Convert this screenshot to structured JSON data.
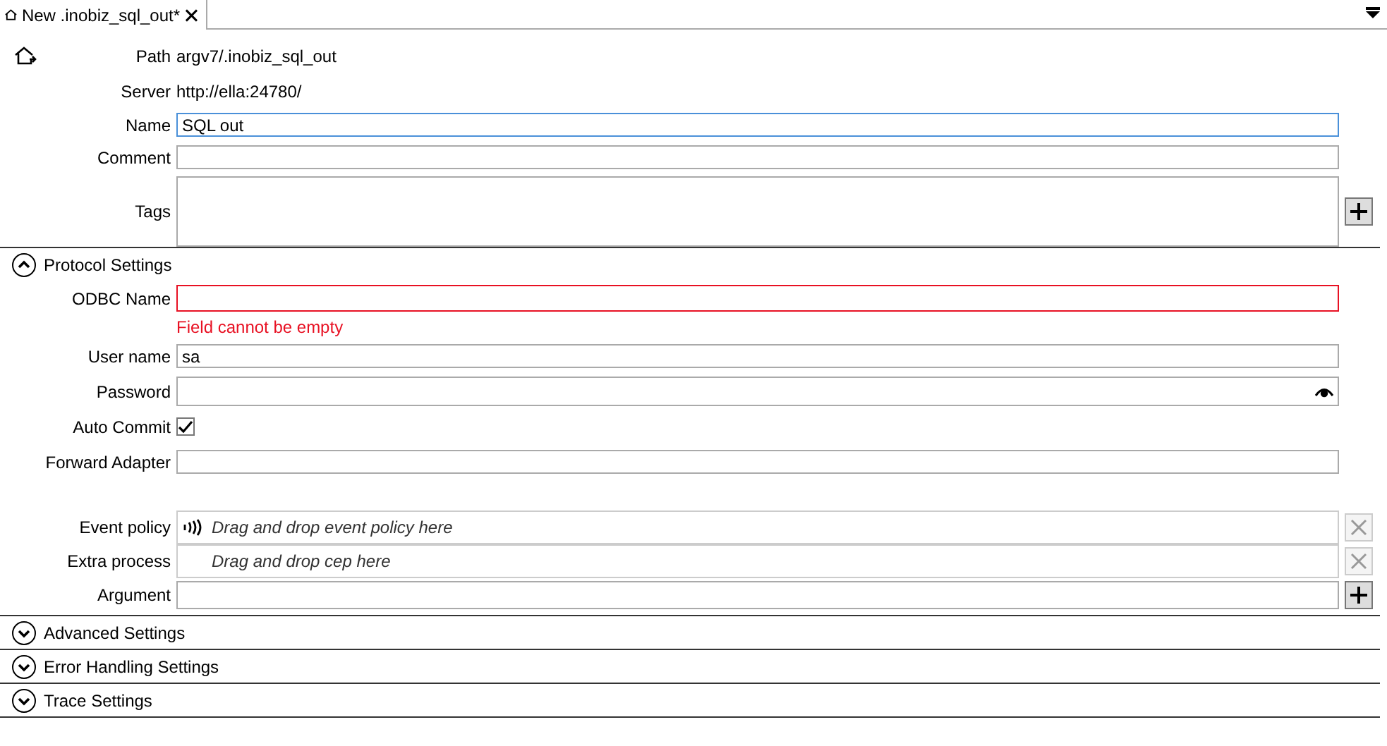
{
  "tab": {
    "title": "New .inobiz_sql_out*"
  },
  "general": [
    {
      "kind": "text",
      "label": "Path",
      "value": "argv7/.inobiz_sql_out"
    },
    {
      "kind": "text",
      "label": "Server",
      "value": "http://ella:24780/"
    },
    {
      "kind": "input",
      "label": "Name",
      "value": "SQL out",
      "focused": true
    },
    {
      "kind": "input",
      "label": "Comment",
      "focused": false
    },
    {
      "kind": "tags",
      "label": "Tags"
    }
  ],
  "sections": [
    {
      "title": "Protocol Settings",
      "expanded": true,
      "fields": [
        {
          "kind": "input",
          "label": "ODBC Name",
          "error": "Field cannot be empty"
        },
        {
          "kind": "input",
          "label": "User name",
          "value": "sa"
        },
        {
          "kind": "password",
          "label": "Password"
        },
        {
          "kind": "checkbox",
          "label": "Auto Commit",
          "checked": true
        },
        {
          "kind": "input",
          "label": "Forward Adapter"
        },
        {
          "kind": "spacer"
        },
        {
          "kind": "drop",
          "label": "Event policy",
          "placeholder": "Drag and drop event policy here",
          "icon": true
        },
        {
          "kind": "drop",
          "label": "Extra process",
          "placeholder": "Drag and drop cep here",
          "icon": false
        },
        {
          "kind": "argument",
          "label": "Argument"
        }
      ]
    },
    {
      "title": "Advanced Settings",
      "expanded": false
    },
    {
      "title": "Error Handling Settings",
      "expanded": false
    },
    {
      "title": "Trace Settings",
      "expanded": false
    }
  ]
}
